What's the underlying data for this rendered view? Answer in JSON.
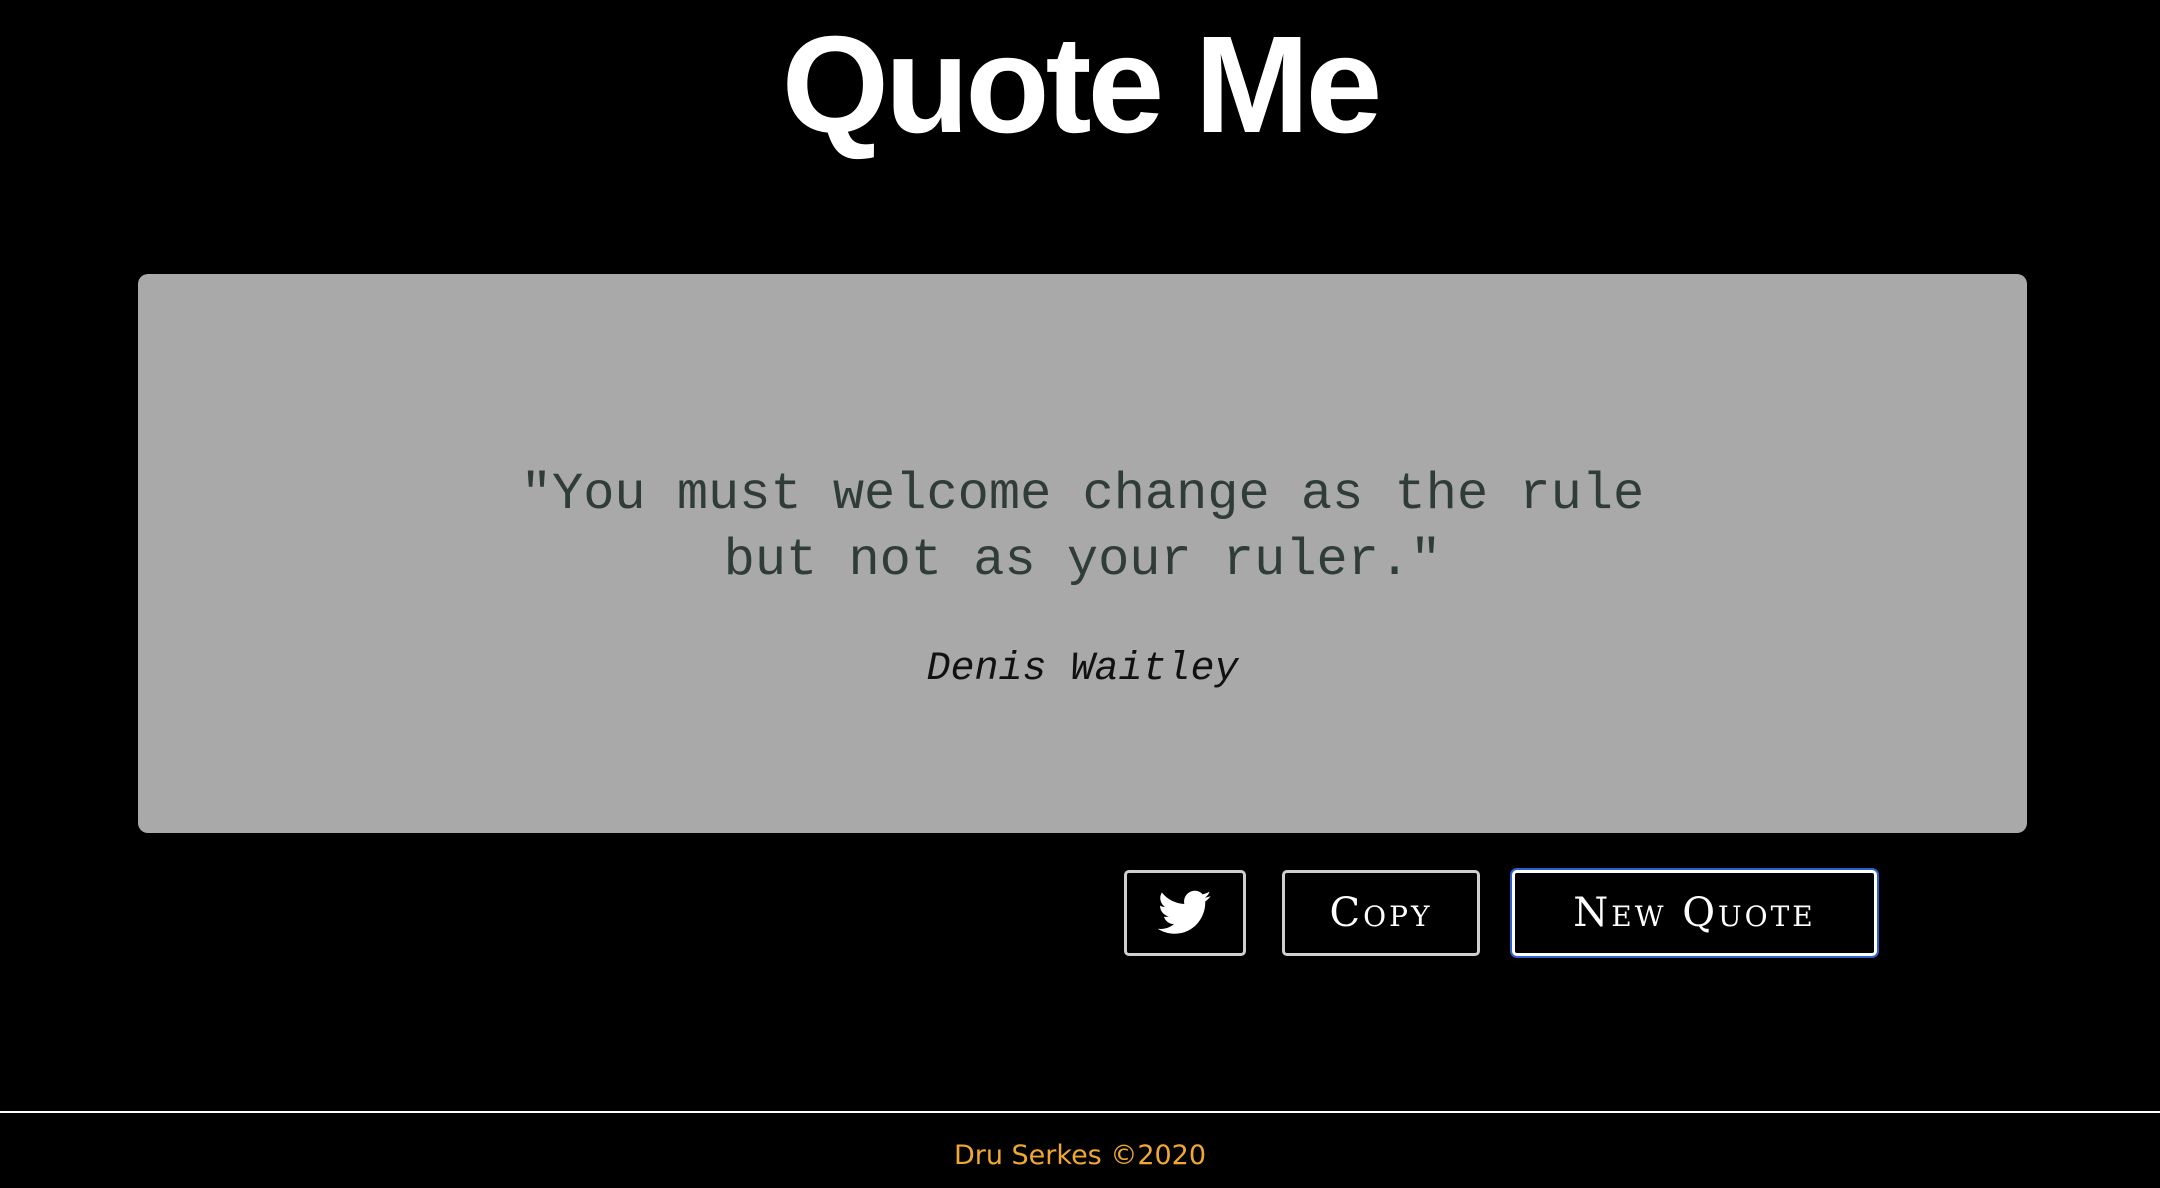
{
  "header": {
    "title": "Quote Me"
  },
  "quote": {
    "text": "\"You must welcome change as the rule but not as your ruler.\"",
    "author": "Denis Waitley"
  },
  "actions": {
    "twitter_icon": "twitter-bird-icon",
    "copy_label": "Copy",
    "new_quote_label": "New Quote"
  },
  "footer": {
    "credit": "Dru Serkes ©2020"
  },
  "colors": {
    "background": "#000000",
    "card": "#a9a9a9",
    "quote_text": "#2f3c38",
    "footer_text": "#f0a830",
    "focus_ring": "#2a62c9"
  }
}
